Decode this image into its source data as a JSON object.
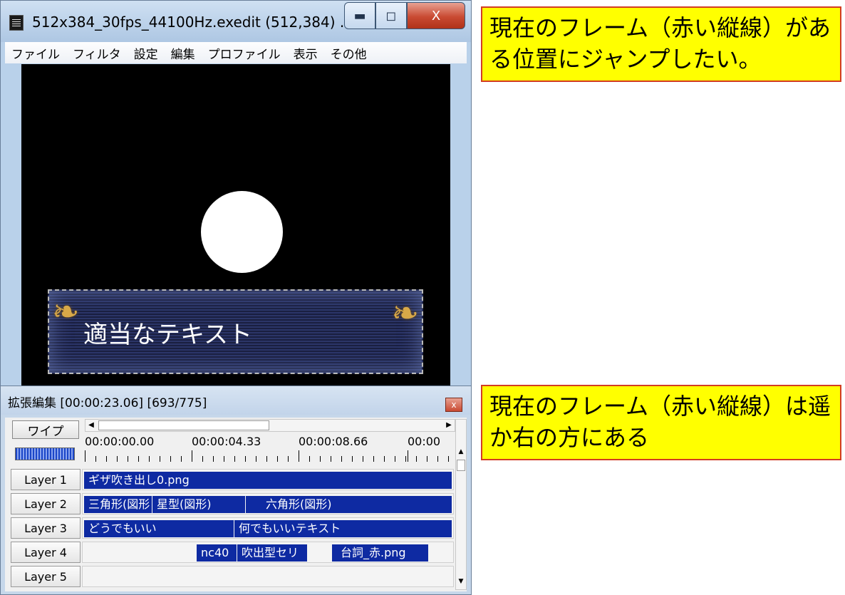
{
  "main_window": {
    "title": "512x384_30fps_44100Hz.exedit (512,384) ...",
    "minimize_icon": "minimize-icon",
    "maximize_icon": "maximize-icon",
    "close_label": "X",
    "menu": [
      "ファイル",
      "フィルタ",
      "設定",
      "編集",
      "プロファイル",
      "表示",
      "その他"
    ],
    "preview": {
      "speech_text": "適当なテキスト"
    }
  },
  "timeline_window": {
    "title": "拡張編集 [00:00:23.06] [693/775]",
    "close_label": "x",
    "scene_button": "ワイプ",
    "ticks": [
      "00:00:00.00",
      "00:00:04.33",
      "00:00:08.66",
      "00:00"
    ],
    "layers": [
      {
        "label": "Layer  1",
        "clips": [
          {
            "text": "ギザ吹き出し0.png"
          }
        ]
      },
      {
        "label": "Layer  2",
        "clips": [
          {
            "text": "三角形(図形"
          },
          {
            "text": "星型(図形)"
          },
          {
            "text": "六角形(図形)"
          }
        ]
      },
      {
        "label": "Layer  3",
        "clips": [
          {
            "text": "どうでもいい"
          },
          {
            "text": "何でもいいテキスト"
          }
        ]
      },
      {
        "label": "Layer  4",
        "clips": [
          {
            "text": "nc40"
          },
          {
            "text": "吹出型セリ"
          },
          {
            "text": "台詞_赤.png"
          }
        ]
      },
      {
        "label": "Layer  5",
        "clips": []
      }
    ]
  },
  "callouts": {
    "top": "現在のフレーム（赤い縦線）がある位置にジャンプしたい。",
    "bottom": "現在のフレーム（赤い縦線）は遥か右の方にある"
  },
  "colors": {
    "clip": "#0e2aa2",
    "callout_bg": "#ffff00",
    "callout_border": "#d23c23"
  }
}
